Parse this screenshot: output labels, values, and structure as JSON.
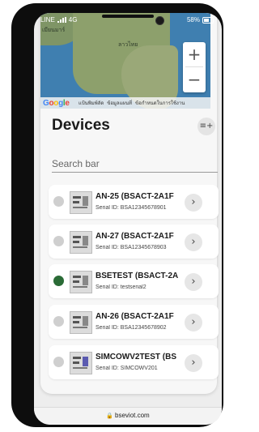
{
  "status_bar": {
    "carrier": "LINE",
    "network": "4G",
    "battery": "58%"
  },
  "map": {
    "label_top": "เมียนมาร์",
    "label_mid": "ลาวไทย",
    "zoom_in": "+",
    "zoom_out": "−",
    "footer_links": [
      "แป้นพิมพ์ลัด",
      "ข้อมูลแผนที่",
      "ข้อกำหนดในการใช้งาน"
    ]
  },
  "header": {
    "title": "Devices",
    "add_icon": "playlist-add-icon"
  },
  "search": {
    "placeholder": "Search bar"
  },
  "devices": [
    {
      "name": "AN-25 (BSACT-2A1F",
      "serial": "Serial ID: BSA12345678901",
      "status": "offline"
    },
    {
      "name": "AN-27 (BSACT-2A1F",
      "serial": "Serial ID: BSA12345678903",
      "status": "offline"
    },
    {
      "name": "BSETEST (BSACT-2A",
      "serial": "Serial ID: testserial2",
      "status": "online"
    },
    {
      "name": "AN-26 (BSACT-2A1F",
      "serial": "Serial ID: BSA12345678902",
      "status": "offline"
    },
    {
      "name": "SIMCOWV2TEST (BS",
      "serial": "Serial ID: SIMCOWV201",
      "status": "offline"
    }
  ],
  "browser": {
    "url": "bseviot.com"
  },
  "colors": {
    "online": "#2a6b36",
    "offline": "#cfcfcf"
  }
}
